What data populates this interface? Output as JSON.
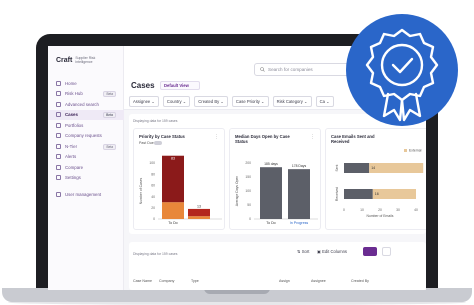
{
  "brand": {
    "name": "Craft",
    "subtitle": "Supplier Risk Intelligence"
  },
  "nav": {
    "items": [
      {
        "label": "Home",
        "name": "home"
      },
      {
        "label": "Risk Hub",
        "name": "risk-hub",
        "badge": "Beta"
      },
      {
        "label": "Advanced search",
        "name": "advanced-search"
      },
      {
        "label": "Cases",
        "name": "cases",
        "badge": "Beta",
        "active": true
      },
      {
        "label": "Portfolios",
        "name": "portfolios"
      },
      {
        "label": "Company requests",
        "name": "company-requests"
      },
      {
        "label": "N-Tier",
        "name": "n-tier",
        "badge": "Beta"
      },
      {
        "label": "Alerts",
        "name": "alerts"
      },
      {
        "label": "Compare",
        "name": "compare"
      },
      {
        "label": "Settings",
        "name": "settings"
      },
      {
        "label": "User management",
        "name": "user-management"
      }
    ]
  },
  "search": {
    "placeholder": "Search for companies"
  },
  "page": {
    "title": "Cases",
    "view": "Default View"
  },
  "filters": [
    "Assignee",
    "Country",
    "Created By",
    "Case Priority",
    "Risk Category",
    "Ca"
  ],
  "dashboard": {
    "note": "Displaying data for 159 cases",
    "cards": [
      {
        "title": "Priority by Case Status",
        "toggle_label": "Past Due"
      },
      {
        "title": "Median Days Open by Case Status"
      },
      {
        "title": "Case Emails Sent and Received"
      }
    ]
  },
  "table": {
    "note": "Displaying data for 159 cases",
    "sort_label": "Sort",
    "columns_label": "Edit Columns",
    "headers": [
      "Case Name",
      "Company",
      "Type",
      "Assign",
      "Assignee",
      "Created By"
    ]
  },
  "colors": {
    "accent": "#6a2c91",
    "high": "#8b1a1a",
    "medium": "#e8873a",
    "low": "#b3261e",
    "grey_bar": "#5c5f68",
    "blue_bar": "#2f6fd6",
    "badge_blue": "#2a66c9",
    "tan_bar": "#e8c89a"
  },
  "chart_data": [
    {
      "type": "bar",
      "title": "Priority by Case Status",
      "categories": [
        "To Do",
        ""
      ],
      "series": [
        {
          "values": [
            30,
            5
          ]
        },
        {
          "values": [
            83,
            13
          ]
        }
      ],
      "ylabel": "Number of Cases",
      "ylim": [
        0,
        100
      ],
      "yticks": [
        0,
        20,
        40,
        60,
        80,
        100
      ],
      "data_labels": [
        "83",
        "13"
      ]
    },
    {
      "type": "bar",
      "title": "Median Days Open by Case Status",
      "categories": [
        "To Do",
        "In Progress"
      ],
      "values": [
        185,
        178
      ],
      "value_labels": [
        "185 days",
        "178 Days"
      ],
      "ylabel": "Average Days Open",
      "ylim": [
        0,
        200
      ],
      "yticks": [
        0,
        50,
        100,
        150,
        200
      ]
    },
    {
      "type": "bar",
      "orientation": "horizontal",
      "title": "Case Emails Sent and Received",
      "categories": [
        "Sent",
        "Received"
      ],
      "series": [
        {
          "name": "Internal",
          "values": [
            14,
            16
          ]
        },
        {
          "name": "External",
          "values": [
            30,
            24
          ]
        }
      ],
      "xlabel": "Number of Emails",
      "xlim": [
        0,
        40
      ],
      "xticks": [
        0,
        10,
        20,
        30,
        40
      ],
      "data_labels": [
        "14",
        "16"
      ]
    }
  ]
}
